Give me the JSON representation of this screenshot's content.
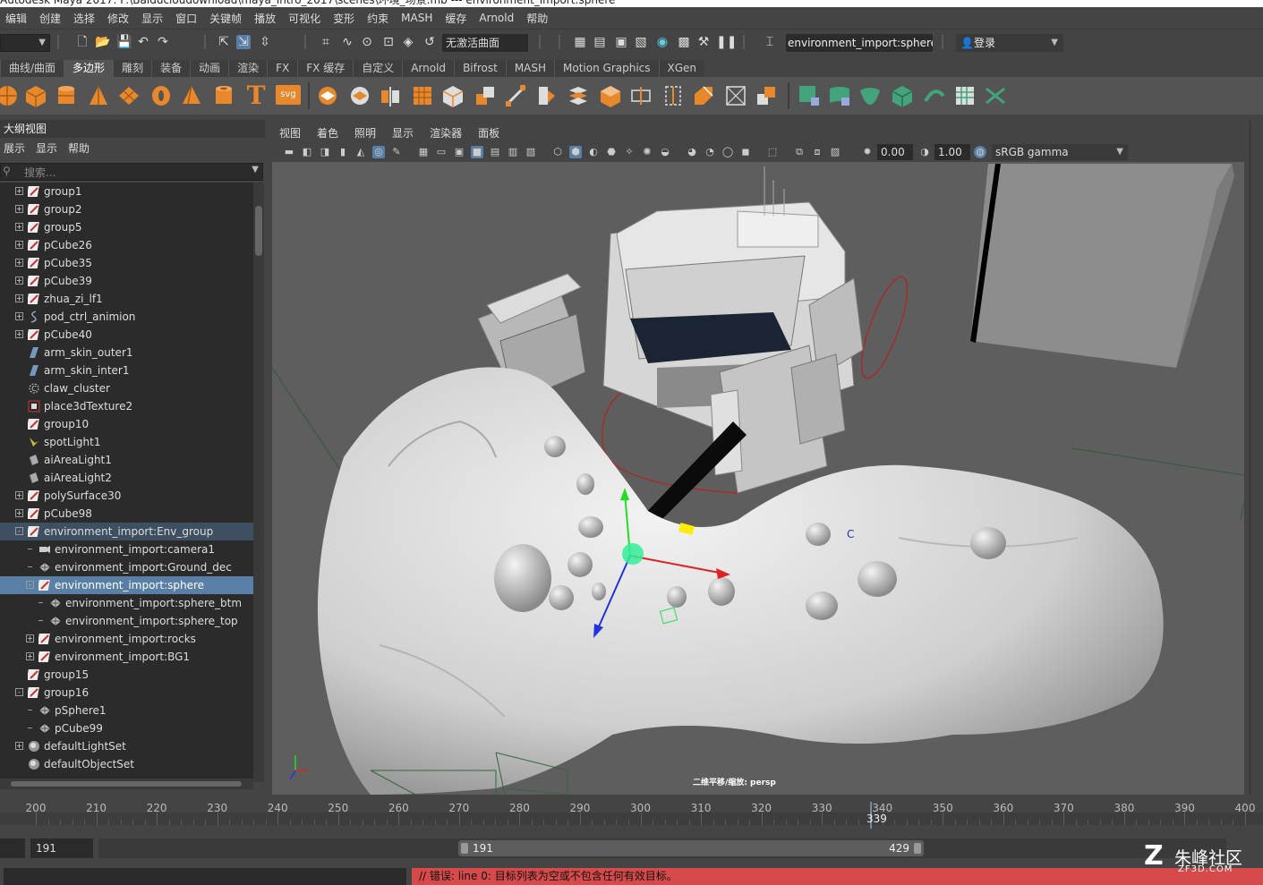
{
  "title_bar": {
    "text": "Autodesk Maya 2017: F:\\Baiducloudownload\\maya_intro_2017\\scenes\\环境_场景.mb  ---  environment_import:sphere"
  },
  "menubar": {
    "items": [
      "编辑",
      "创建",
      "选择",
      "修改",
      "显示",
      "窗口",
      "关键帧",
      "播放",
      "可视化",
      "变形",
      "约束",
      "MASH",
      "缓存",
      "Arnold",
      "帮助"
    ]
  },
  "status_line": {
    "no_live_surface": "无激活曲面",
    "selection_field": "environment_import:sphere",
    "login_label": "登录"
  },
  "shelf": {
    "tabs": [
      "曲线/曲面",
      "多边形",
      "雕刻",
      "装备",
      "动画",
      "渲染",
      "FX",
      "FX 缓存",
      "自定义",
      "Arnold",
      "Bifrost",
      "MASH",
      "Motion Graphics",
      "XGen"
    ],
    "active_tab": "多边形",
    "text_icon": "T",
    "svg_icon": "svg"
  },
  "outliner": {
    "title": "大纲视图",
    "menu": [
      "展示",
      "显示",
      "帮助"
    ],
    "search_placeholder": "搜索...",
    "items": [
      {
        "label": "group1",
        "icon": "transform-icon"
      },
      {
        "label": "group2",
        "icon": "transform-icon"
      },
      {
        "label": "group5",
        "icon": "transform-icon"
      },
      {
        "label": "pCube26",
        "icon": "transform-icon"
      },
      {
        "label": "pCube35",
        "icon": "transform-icon"
      },
      {
        "label": "pCube39",
        "icon": "transform-icon"
      },
      {
        "label": "zhua_zi_lf1",
        "icon": "transform-icon"
      },
      {
        "label": "pod_ctrl_animion",
        "icon": "curve-icon"
      },
      {
        "label": "pCube40",
        "icon": "transform-icon"
      },
      {
        "label": "arm_skin_outer1",
        "icon": "nurbs-surface-icon"
      },
      {
        "label": "arm_skin_inter1",
        "icon": "nurbs-surface-icon"
      },
      {
        "label": "claw_cluster",
        "icon": "cluster-icon"
      },
      {
        "label": "place3dTexture2",
        "icon": "place3d-texture-icon"
      },
      {
        "label": "group10",
        "icon": "transform-icon"
      },
      {
        "label": "spotLight1",
        "icon": "spot-light-icon"
      },
      {
        "label": "aiAreaLight1",
        "icon": "area-light-icon"
      },
      {
        "label": "aiAreaLight2",
        "icon": "area-light-icon"
      },
      {
        "label": "polySurface30",
        "icon": "transform-icon"
      },
      {
        "label": "pCube98",
        "icon": "transform-icon"
      },
      {
        "label": "environment_import:Env_group",
        "icon": "transform-icon"
      },
      {
        "label": "environment_import:camera1",
        "icon": "camera-icon"
      },
      {
        "label": "environment_import:Ground_dec",
        "icon": "mesh-icon"
      },
      {
        "label": "environment_import:sphere",
        "icon": "transform-icon"
      },
      {
        "label": "environment_import:sphere_btm",
        "icon": "mesh-icon"
      },
      {
        "label": "environment_import:sphere_top",
        "icon": "mesh-icon"
      },
      {
        "label": "environment_import:rocks",
        "icon": "transform-icon"
      },
      {
        "label": "environment_import:BG1",
        "icon": "transform-icon"
      },
      {
        "label": "group15",
        "icon": "transform-icon"
      },
      {
        "label": "group16",
        "icon": "transform-icon"
      },
      {
        "label": "pSphere1",
        "icon": "mesh-icon"
      },
      {
        "label": "pCube99",
        "icon": "mesh-icon"
      },
      {
        "label": "defaultLightSet",
        "icon": "set-icon"
      },
      {
        "label": "defaultObjectSet",
        "icon": "set-icon"
      }
    ]
  },
  "viewport": {
    "menu": [
      "视图",
      "着色",
      "照明",
      "显示",
      "渲染器",
      "面板"
    ],
    "exposure": "0.00",
    "gamma": "1.00",
    "color_space": "sRGB gamma",
    "camera_label": "二维平移/缩放: persp",
    "component_label": "C"
  },
  "time_slider": {
    "ticks": [
      "200",
      "210",
      "220",
      "230",
      "240",
      "250",
      "260",
      "270",
      "280",
      "290",
      "300",
      "310",
      "320",
      "330",
      "340",
      "350",
      "360",
      "370",
      "380",
      "390",
      "400"
    ],
    "current_frame": "339"
  },
  "range_slider": {
    "start": "191",
    "range_start": "191",
    "range_end": "429"
  },
  "command_line": {
    "error": "// 错误: line 0: 目标列表为空或不包含任何有效目标。"
  },
  "watermark": {
    "text": "朱峰社区",
    "sub": "ZF3D.COM"
  },
  "colors": {
    "selection": "#5a7fa6",
    "error": "#d64a4a",
    "accent_green": "#43a37a"
  }
}
